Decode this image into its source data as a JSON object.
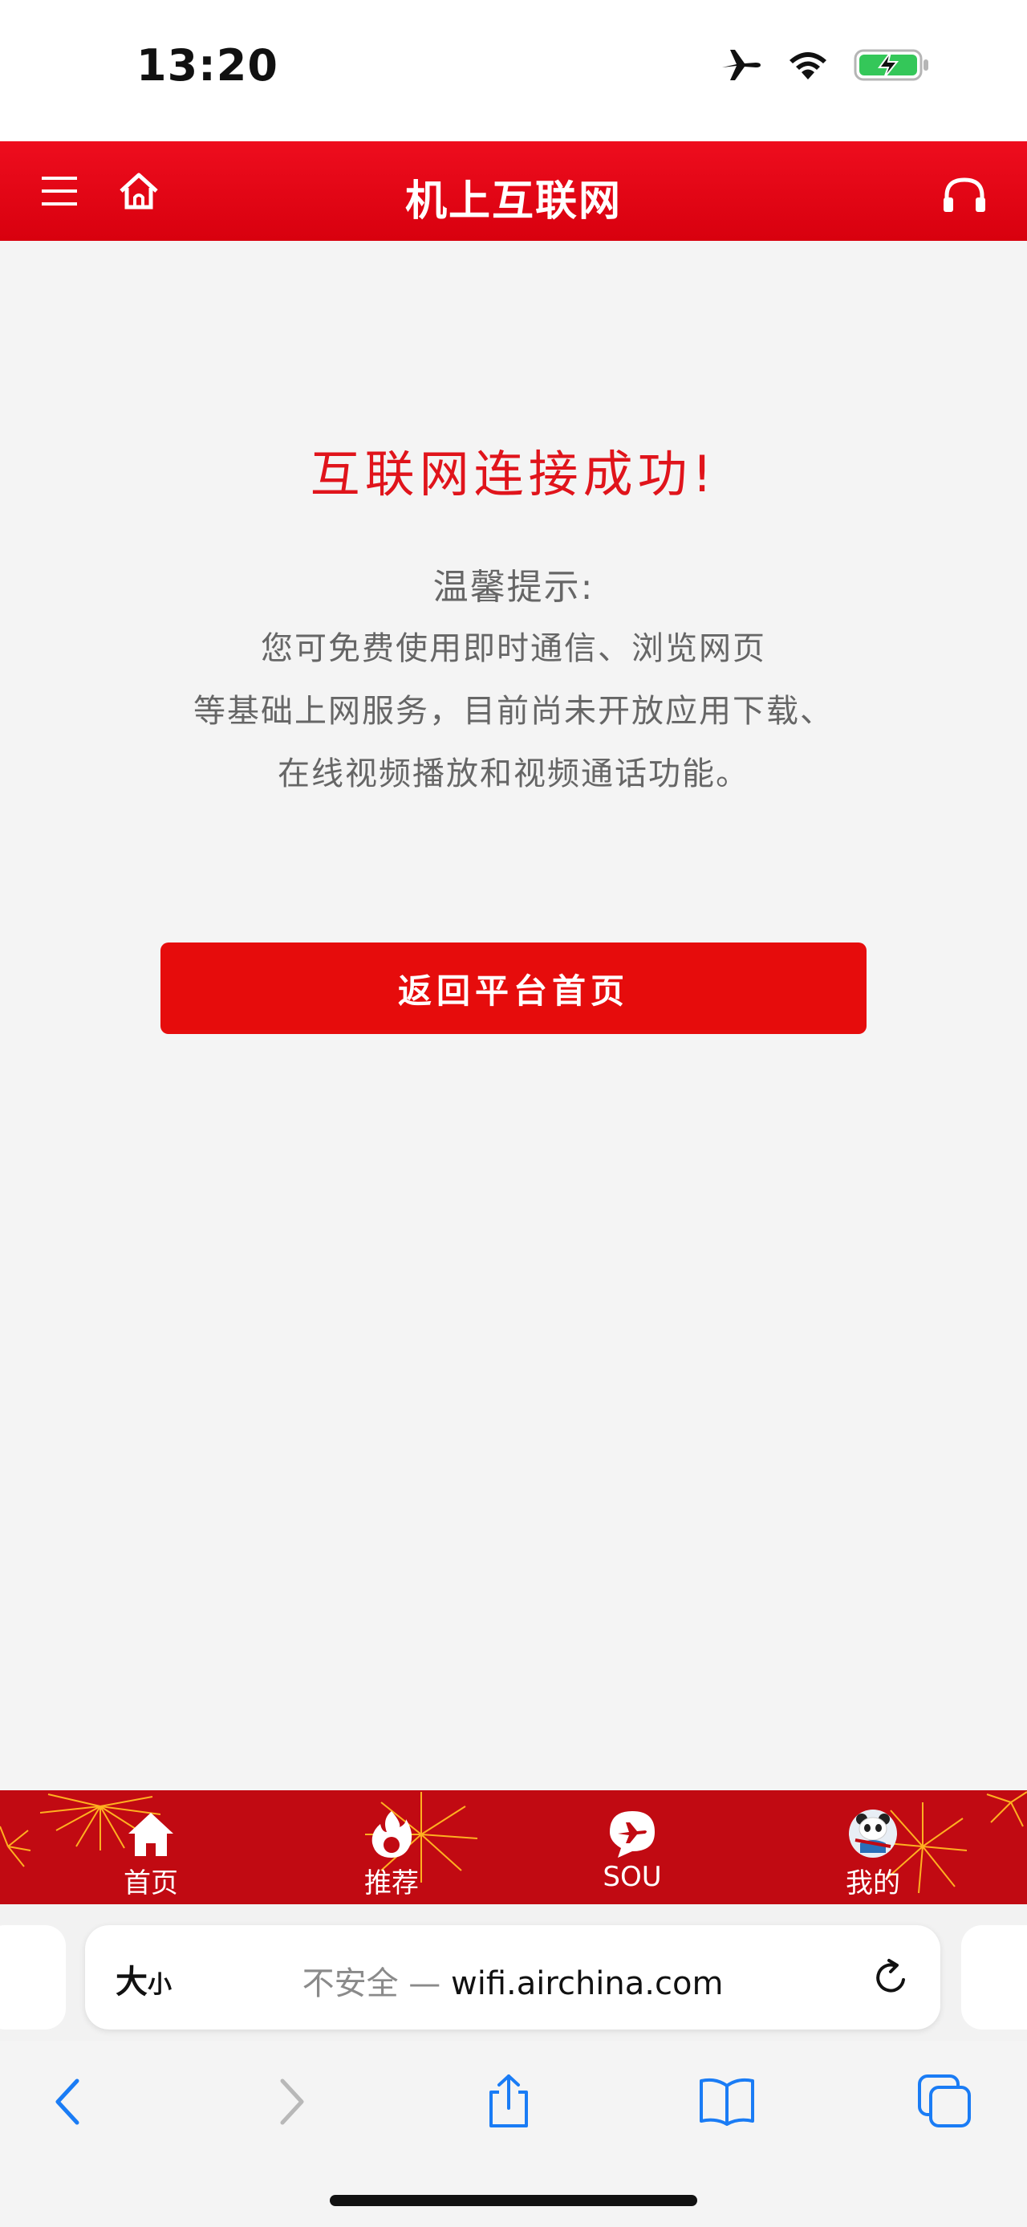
{
  "status_bar": {
    "time": "13:20",
    "icons": [
      "airplane-icon",
      "wifi-icon",
      "battery-charging-icon"
    ]
  },
  "header": {
    "title": "机上互联网",
    "icons": [
      "menu-icon",
      "home-icon",
      "headset-icon"
    ]
  },
  "main": {
    "success_title": "互联网连接成功!",
    "tip_heading": "温馨提示:",
    "tip_lines": [
      "您可免费使用即时通信、浏览网页",
      "等基础上网服务，目前尚未开放应用下载、",
      "在线视频播放和视频通话功能。"
    ],
    "return_button": "返回平台首页"
  },
  "tabbar": {
    "items": [
      {
        "label": "首页",
        "icon": "home-icon"
      },
      {
        "label": "推荐",
        "icon": "flame-icon"
      },
      {
        "label": "SOU",
        "icon": "plane-bubble-icon"
      },
      {
        "label": "我的",
        "icon": "panda-avatar-icon"
      }
    ]
  },
  "browser": {
    "text_size_big": "大",
    "text_size_small": "小",
    "insecure_label": "不安全 —",
    "url": "wifi.airchina.com"
  },
  "colors": {
    "brand_red": "#e60c0c",
    "header_red": "#d8000e",
    "tabbar_red": "#c10a12",
    "ios_blue": "#1a7cf5"
  }
}
